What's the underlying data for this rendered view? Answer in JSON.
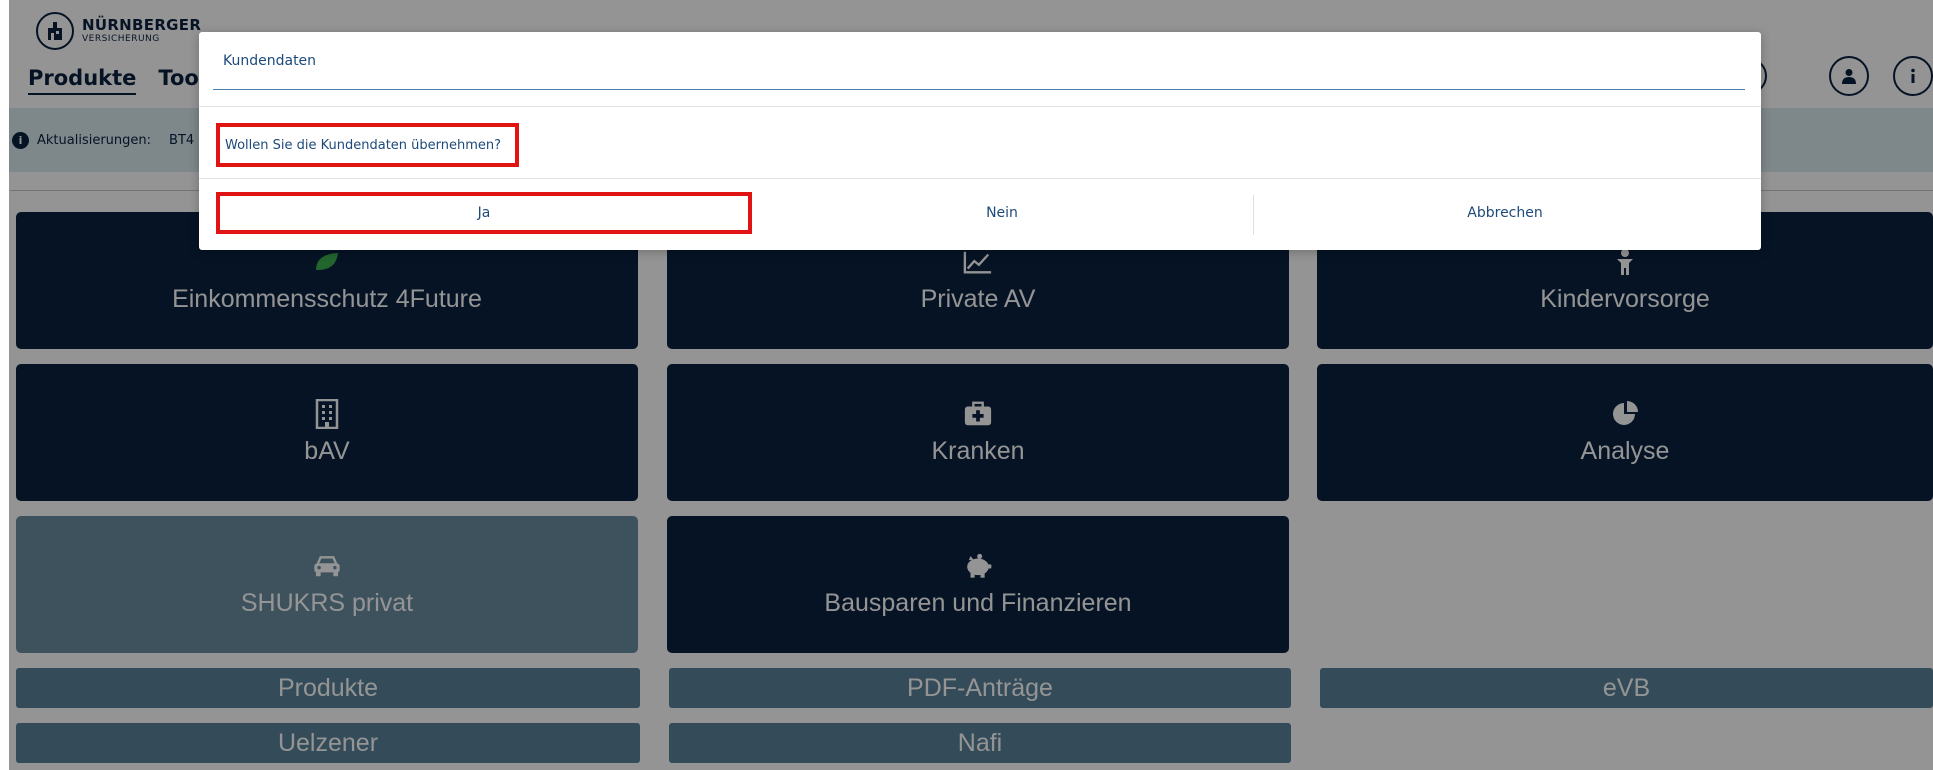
{
  "brand": {
    "name": "NÜRNBERGER",
    "sub": "VERSICHERUNG"
  },
  "nav": {
    "items": [
      {
        "label": "Produkte",
        "active": true
      },
      {
        "label": "Tools",
        "active": false
      }
    ]
  },
  "header_icons": [
    "user-icon",
    "info-icon"
  ],
  "infobar": {
    "label": "Aktualisierungen:",
    "items": "BT4"
  },
  "tiles": [
    {
      "label": "Einkommensschutz 4Future",
      "icon": "leaf-icon"
    },
    {
      "label": "Private AV",
      "icon": "chart-line-icon"
    },
    {
      "label": "Kindervorsorge",
      "icon": "child-icon"
    },
    {
      "label": "bAV",
      "icon": "building-icon"
    },
    {
      "label": "Kranken",
      "icon": "medical-kit-icon"
    },
    {
      "label": "Analyse",
      "icon": "pie-chart-icon"
    },
    {
      "label": "SHUKRS privat",
      "icon": "car-icon"
    },
    {
      "label": "Bausparen und Finanzieren",
      "icon": "piggy-bank-icon"
    }
  ],
  "links": [
    {
      "label": "Produkte"
    },
    {
      "label": "PDF-Anträge"
    },
    {
      "label": "eVB"
    },
    {
      "label": "Uelzener"
    },
    {
      "label": "Nafi"
    }
  ],
  "dialog": {
    "title": "Kundendaten",
    "message": "Wollen Sie die Kundendaten übernehmen?",
    "buttons": {
      "yes": "Ja",
      "no": "Nein",
      "cancel": "Abbrechen"
    }
  },
  "colors": {
    "tile": "#0a2240",
    "tile_muted": "#6b8ea3",
    "link_tile": "#5a8299",
    "highlight": "#e11414",
    "infobar": "#d9e8ee"
  }
}
